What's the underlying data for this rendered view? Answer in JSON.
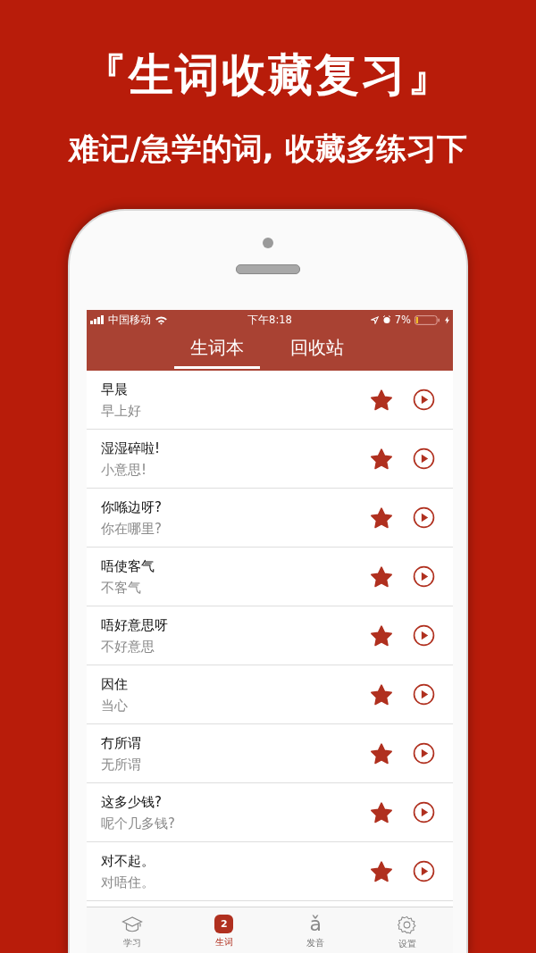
{
  "headline": "『生词收藏复习』",
  "subheadline": "难记/急学的词, 收藏多练习下",
  "status_bar": {
    "carrier": "中国移动",
    "time": "下午8:18",
    "battery": "7%"
  },
  "tabs": [
    {
      "label": "生词本",
      "selected": true
    },
    {
      "label": "回收站",
      "selected": false
    }
  ],
  "words": [
    {
      "word": "早晨",
      "meaning": "早上好",
      "starred": true
    },
    {
      "word": "湿湿碎啦!",
      "meaning": "小意思!",
      "starred": true
    },
    {
      "word": "你喺边呀?",
      "meaning": "你在哪里?",
      "starred": true
    },
    {
      "word": "唔使客气",
      "meaning": "不客气",
      "starred": true
    },
    {
      "word": "唔好意思呀",
      "meaning": "不好意思",
      "starred": true
    },
    {
      "word": "因住",
      "meaning": "当心",
      "starred": true
    },
    {
      "word": "冇所谓",
      "meaning": "无所谓",
      "starred": true
    },
    {
      "word": "这多少钱?",
      "meaning": "呢个几多钱?",
      "starred": true
    },
    {
      "word": "对不起。",
      "meaning": "对唔住。",
      "starred": true
    }
  ],
  "nav": [
    {
      "kind": "cap",
      "label": "学习",
      "selected": false
    },
    {
      "kind": "review",
      "glyph": "2",
      "label": "生词",
      "selected": true
    },
    {
      "kind": "letter",
      "glyph": "ǎ",
      "label": "发音",
      "selected": false
    },
    {
      "kind": "gear",
      "label": "设置",
      "selected": false
    }
  ]
}
